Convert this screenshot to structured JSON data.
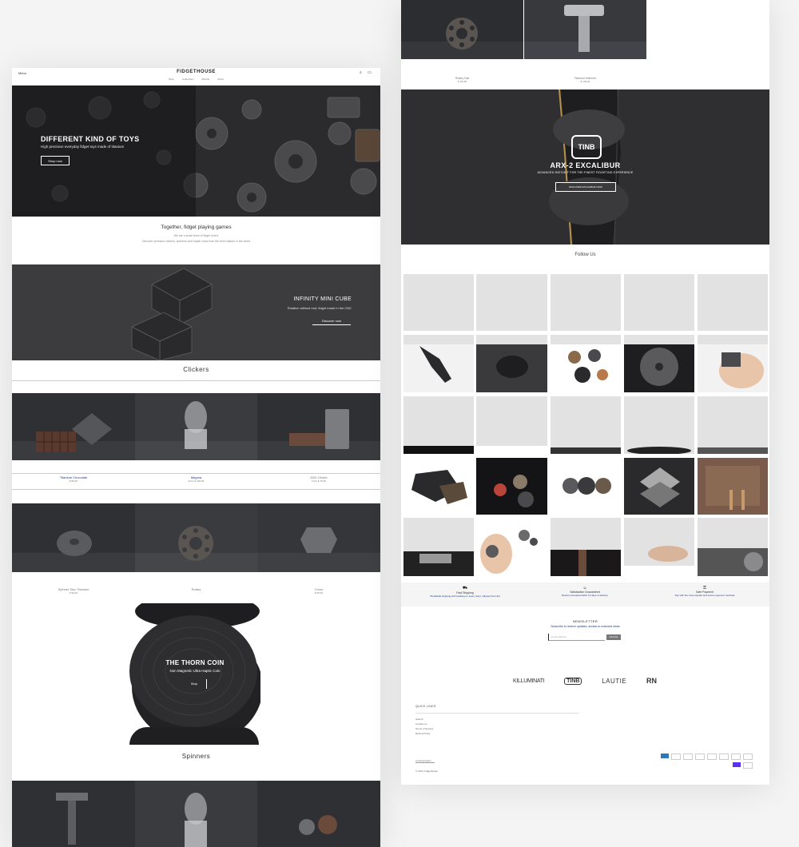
{
  "header": {
    "menu_label": "Menu",
    "brand": "FIDGETHOUSE",
    "nav": [
      "Shop",
      "Collections",
      "Brands",
      "About"
    ]
  },
  "hero": {
    "title": "DIFFERENT KIND OF TOYS",
    "subtitle": "High precision everyday fidget toys made of titanium",
    "button": "Shop now"
  },
  "intro": {
    "title": "Together, fidget playing games",
    "line1": "We are a small team of fidget lovers",
    "line2": "Discover premium clickers, spinners and haptic coins from the best makers in the world"
  },
  "banner2": {
    "title": "INFINITY MINI CUBE",
    "subtitle": "Rotation without end, fidget made in the CNC",
    "button": "Discover now"
  },
  "clickers": {
    "title": "Clickers",
    "products": [
      {
        "name": "Titanium Chocolate",
        "price": "€ 89,00"
      },
      {
        "name": "Magma",
        "price": "From € 129,00"
      },
      {
        "name": "ASD Clicker",
        "price": "From € 75,00"
      }
    ]
  },
  "row2": {
    "products": [
      {
        "name": "Spinner Disc Titanium",
        "price": "€ 99,00"
      },
      {
        "name": "Rotary",
        "price": "€ 119,00"
      },
      {
        "name": "Cross",
        "price": "€ 65,00"
      }
    ]
  },
  "coin": {
    "title": "THE THORN COIN",
    "subtitle": "Non Magnetic Ultra Haptic Coin",
    "button": "Shop"
  },
  "spinners": {
    "title": "Spinners"
  },
  "right_top": {
    "products": [
      {
        "name": "Rotary Dial",
        "price": "€ 119,00"
      },
      {
        "name": "Titanium Hammer",
        "price": "€ 149,00"
      }
    ]
  },
  "excalibur": {
    "logo": "TINB",
    "title": "ARX-2 EXCALIBUR",
    "subtitle": "ADVANCED RATCHET FOR THE FINEST FIDGETING EXPERIENCE",
    "button": "DISCOVER EXCALIBUR NOW"
  },
  "follow": {
    "title": "Follow Us"
  },
  "features": [
    {
      "title": "Fast Shipping",
      "text": "Worldwide shipping with tracking on every order, shipped from EU"
    },
    {
      "title": "Satisfaction Guaranteed",
      "text": "Returns accepted within 14 days of delivery"
    },
    {
      "title": "Safe Payment",
      "text": "Pay with the most popular and secure payment methods"
    }
  ],
  "newsletter": {
    "title": "NEWSLETTER",
    "text": "Subscribe to receive updates, access to exclusive deals",
    "placeholder": "Email address",
    "button": "Subscribe"
  },
  "brands": [
    "KILLUMINATI",
    "TINB",
    "LAUTIE",
    "RN"
  ],
  "footer": {
    "heading": "QUICK LINKS",
    "links": [
      "Search",
      "Contact us",
      "Terms of Service",
      "Refund Policy"
    ],
    "country": "Country/region",
    "copyright": "© 2024, Fidgethouse"
  },
  "payments": [
    "American Express",
    "Apple Pay",
    "Bancontact",
    "Google Pay",
    "iDEAL",
    "Maestro",
    "Mastercard",
    "Shop Pay",
    "Union Pay",
    "Visa"
  ],
  "colors": {
    "accent": "#1a3b8f",
    "dark": "#2a2a2c",
    "gold": "#b8944a"
  }
}
